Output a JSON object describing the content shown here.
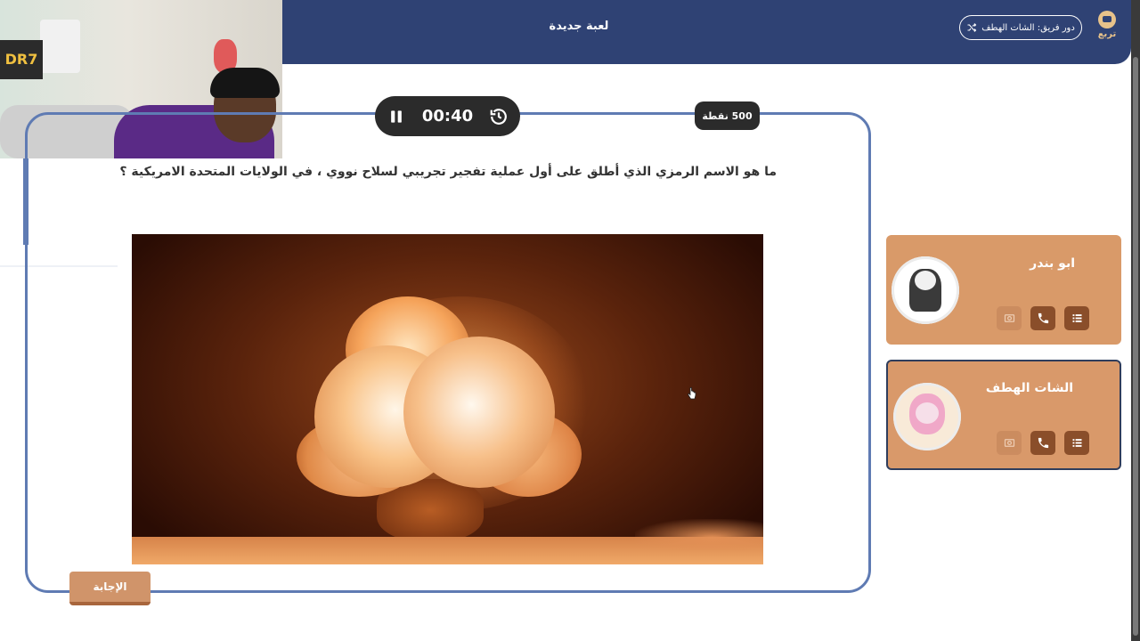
{
  "header": {
    "title": "لعبة جديدة",
    "turn_label": "دور فريق: الشات الهطف",
    "logo_text": "تربع"
  },
  "webcam": {
    "sign_text": "DR7"
  },
  "question_card": {
    "timer": "00:40",
    "points": "500 نقطة",
    "question": "ما هو الاسم الرمزي الذي أطلق على أول عملية تفجير تجريبي لسلاح نووي ، في الولايات المتحدة الامريكية ؟",
    "answer_button": "الإجابة"
  },
  "players": [
    {
      "name": "ابو بندر"
    },
    {
      "name": "الشات الهطف"
    }
  ],
  "colors": {
    "header_bg": "#2f4274",
    "card_border": "#5f7bb3",
    "player_card": "#d99a69",
    "tool_dark": "#8a4e2a",
    "answer_button": "#d0946a"
  },
  "icons": {
    "timer_pause": "pause-icon",
    "timer_reset": "history-icon",
    "turn_switch": "shuffle-icon",
    "player_tools": [
      "image-icon",
      "phone-icon",
      "list-icon"
    ]
  }
}
